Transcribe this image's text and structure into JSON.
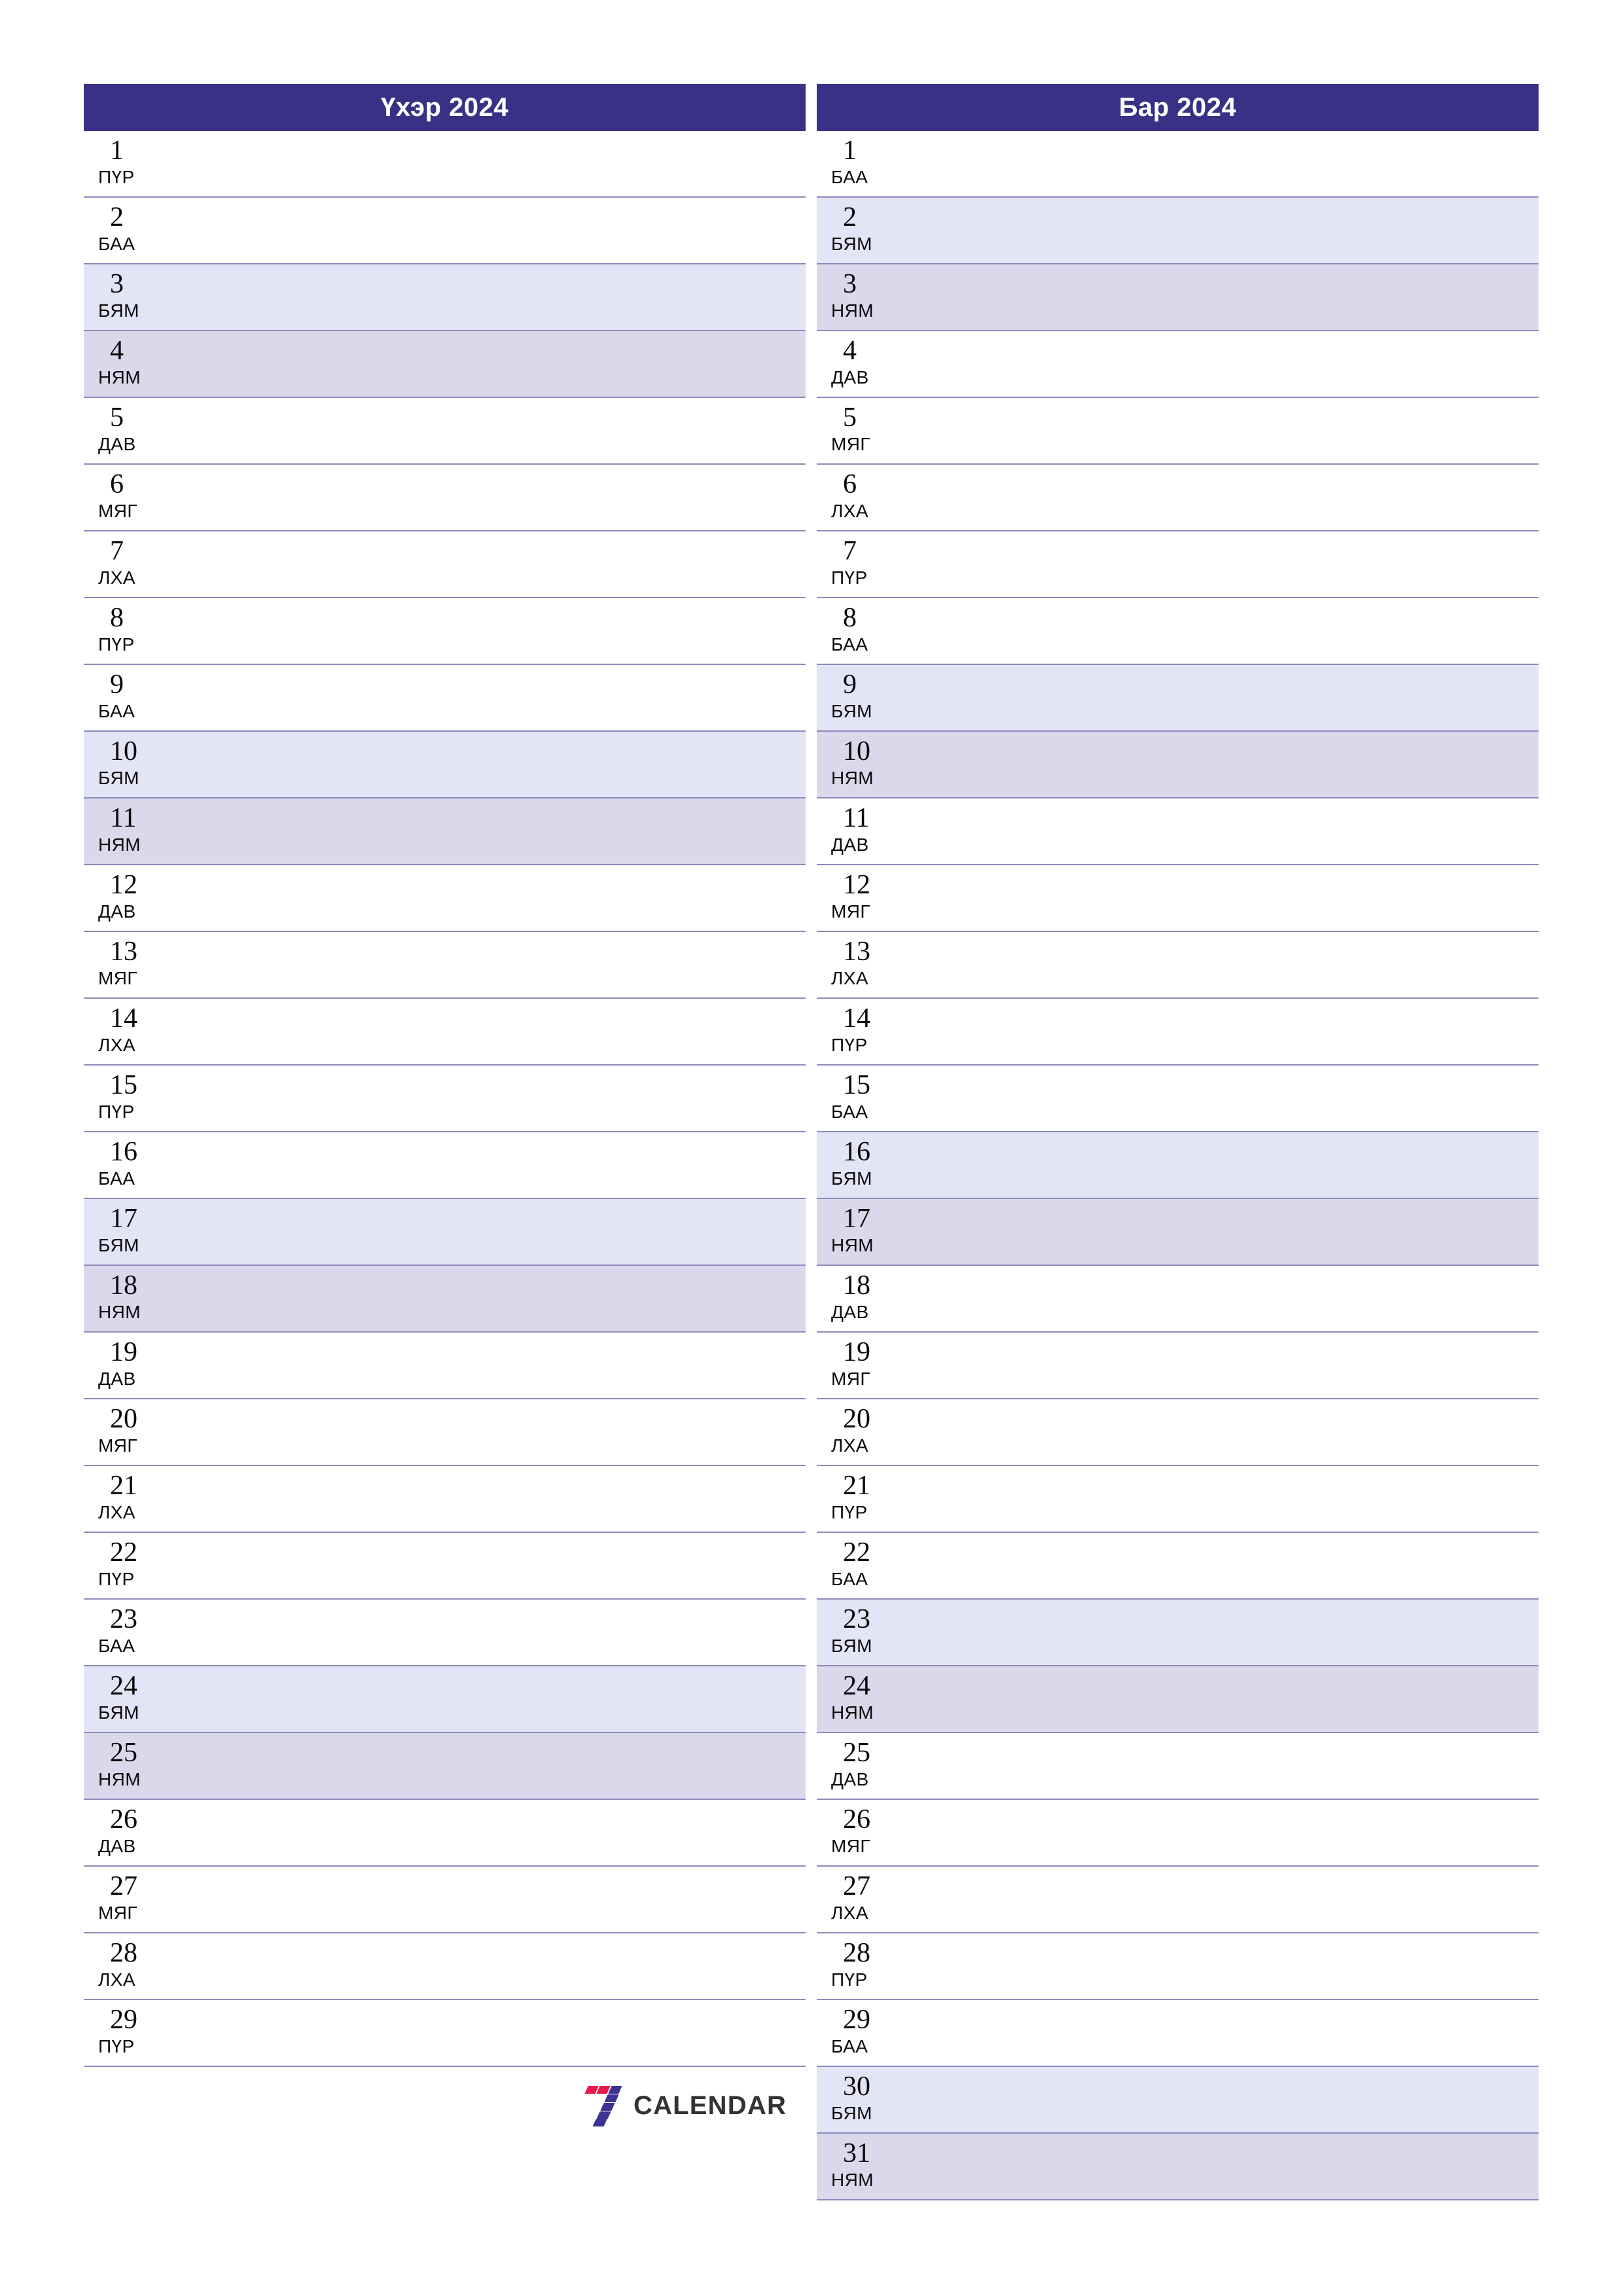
{
  "document": {
    "type": "monthly-planner-calendar",
    "page_background": "#ffffff"
  },
  "colors": {
    "header_bg": "#383185",
    "header_text": "#ffffff",
    "row_border": "#8b8bbd",
    "saturday_bg": "#e4e4f7",
    "sunday_bg": "#dcd8ec",
    "day_text": "#0a0a0a",
    "logo_red": "#ed1847",
    "logo_purple": "#3b3292",
    "logo_text": "#333333"
  },
  "panels": [
    {
      "id": "left-month",
      "title": "Үхэр 2024",
      "days": [
        {
          "num": "1",
          "weekday": "ПҮР",
          "type": "weekday"
        },
        {
          "num": "2",
          "weekday": "БАА",
          "type": "weekday"
        },
        {
          "num": "3",
          "weekday": "БЯМ",
          "type": "saturday"
        },
        {
          "num": "4",
          "weekday": "НЯМ",
          "type": "sunday"
        },
        {
          "num": "5",
          "weekday": "ДАВ",
          "type": "weekday"
        },
        {
          "num": "6",
          "weekday": "МЯГ",
          "type": "weekday"
        },
        {
          "num": "7",
          "weekday": "ЛХА",
          "type": "weekday"
        },
        {
          "num": "8",
          "weekday": "ПҮР",
          "type": "weekday"
        },
        {
          "num": "9",
          "weekday": "БАА",
          "type": "weekday"
        },
        {
          "num": "10",
          "weekday": "БЯМ",
          "type": "saturday"
        },
        {
          "num": "11",
          "weekday": "НЯМ",
          "type": "sunday"
        },
        {
          "num": "12",
          "weekday": "ДАВ",
          "type": "weekday"
        },
        {
          "num": "13",
          "weekday": "МЯГ",
          "type": "weekday"
        },
        {
          "num": "14",
          "weekday": "ЛХА",
          "type": "weekday"
        },
        {
          "num": "15",
          "weekday": "ПҮР",
          "type": "weekday"
        },
        {
          "num": "16",
          "weekday": "БАА",
          "type": "weekday"
        },
        {
          "num": "17",
          "weekday": "БЯМ",
          "type": "saturday"
        },
        {
          "num": "18",
          "weekday": "НЯМ",
          "type": "sunday"
        },
        {
          "num": "19",
          "weekday": "ДАВ",
          "type": "weekday"
        },
        {
          "num": "20",
          "weekday": "МЯГ",
          "type": "weekday"
        },
        {
          "num": "21",
          "weekday": "ЛХА",
          "type": "weekday"
        },
        {
          "num": "22",
          "weekday": "ПҮР",
          "type": "weekday"
        },
        {
          "num": "23",
          "weekday": "БАА",
          "type": "weekday"
        },
        {
          "num": "24",
          "weekday": "БЯМ",
          "type": "saturday"
        },
        {
          "num": "25",
          "weekday": "НЯМ",
          "type": "sunday"
        },
        {
          "num": "26",
          "weekday": "ДАВ",
          "type": "weekday"
        },
        {
          "num": "27",
          "weekday": "МЯГ",
          "type": "weekday"
        },
        {
          "num": "28",
          "weekday": "ЛХА",
          "type": "weekday"
        },
        {
          "num": "29",
          "weekday": "ПҮР",
          "type": "weekday"
        }
      ]
    },
    {
      "id": "right-month",
      "title": "Бар 2024",
      "days": [
        {
          "num": "1",
          "weekday": "БАА",
          "type": "weekday"
        },
        {
          "num": "2",
          "weekday": "БЯМ",
          "type": "saturday"
        },
        {
          "num": "3",
          "weekday": "НЯМ",
          "type": "sunday"
        },
        {
          "num": "4",
          "weekday": "ДАВ",
          "type": "weekday"
        },
        {
          "num": "5",
          "weekday": "МЯГ",
          "type": "weekday"
        },
        {
          "num": "6",
          "weekday": "ЛХА",
          "type": "weekday"
        },
        {
          "num": "7",
          "weekday": "ПҮР",
          "type": "weekday"
        },
        {
          "num": "8",
          "weekday": "БАА",
          "type": "weekday"
        },
        {
          "num": "9",
          "weekday": "БЯМ",
          "type": "saturday"
        },
        {
          "num": "10",
          "weekday": "НЯМ",
          "type": "sunday"
        },
        {
          "num": "11",
          "weekday": "ДАВ",
          "type": "weekday"
        },
        {
          "num": "12",
          "weekday": "МЯГ",
          "type": "weekday"
        },
        {
          "num": "13",
          "weekday": "ЛХА",
          "type": "weekday"
        },
        {
          "num": "14",
          "weekday": "ПҮР",
          "type": "weekday"
        },
        {
          "num": "15",
          "weekday": "БАА",
          "type": "weekday"
        },
        {
          "num": "16",
          "weekday": "БЯМ",
          "type": "saturday"
        },
        {
          "num": "17",
          "weekday": "НЯМ",
          "type": "sunday"
        },
        {
          "num": "18",
          "weekday": "ДАВ",
          "type": "weekday"
        },
        {
          "num": "19",
          "weekday": "МЯГ",
          "type": "weekday"
        },
        {
          "num": "20",
          "weekday": "ЛХА",
          "type": "weekday"
        },
        {
          "num": "21",
          "weekday": "ПҮР",
          "type": "weekday"
        },
        {
          "num": "22",
          "weekday": "БАА",
          "type": "weekday"
        },
        {
          "num": "23",
          "weekday": "БЯМ",
          "type": "saturday"
        },
        {
          "num": "24",
          "weekday": "НЯМ",
          "type": "sunday"
        },
        {
          "num": "25",
          "weekday": "ДАВ",
          "type": "weekday"
        },
        {
          "num": "26",
          "weekday": "МЯГ",
          "type": "weekday"
        },
        {
          "num": "27",
          "weekday": "ЛХА",
          "type": "weekday"
        },
        {
          "num": "28",
          "weekday": "ПҮР",
          "type": "weekday"
        },
        {
          "num": "29",
          "weekday": "БАА",
          "type": "weekday"
        },
        {
          "num": "30",
          "weekday": "БЯМ",
          "type": "saturday"
        },
        {
          "num": "31",
          "weekday": "НЯМ",
          "type": "sunday"
        }
      ]
    }
  ],
  "logo": {
    "mark_name": "seven-calendar-logo-icon",
    "text": "CALENDAR"
  }
}
